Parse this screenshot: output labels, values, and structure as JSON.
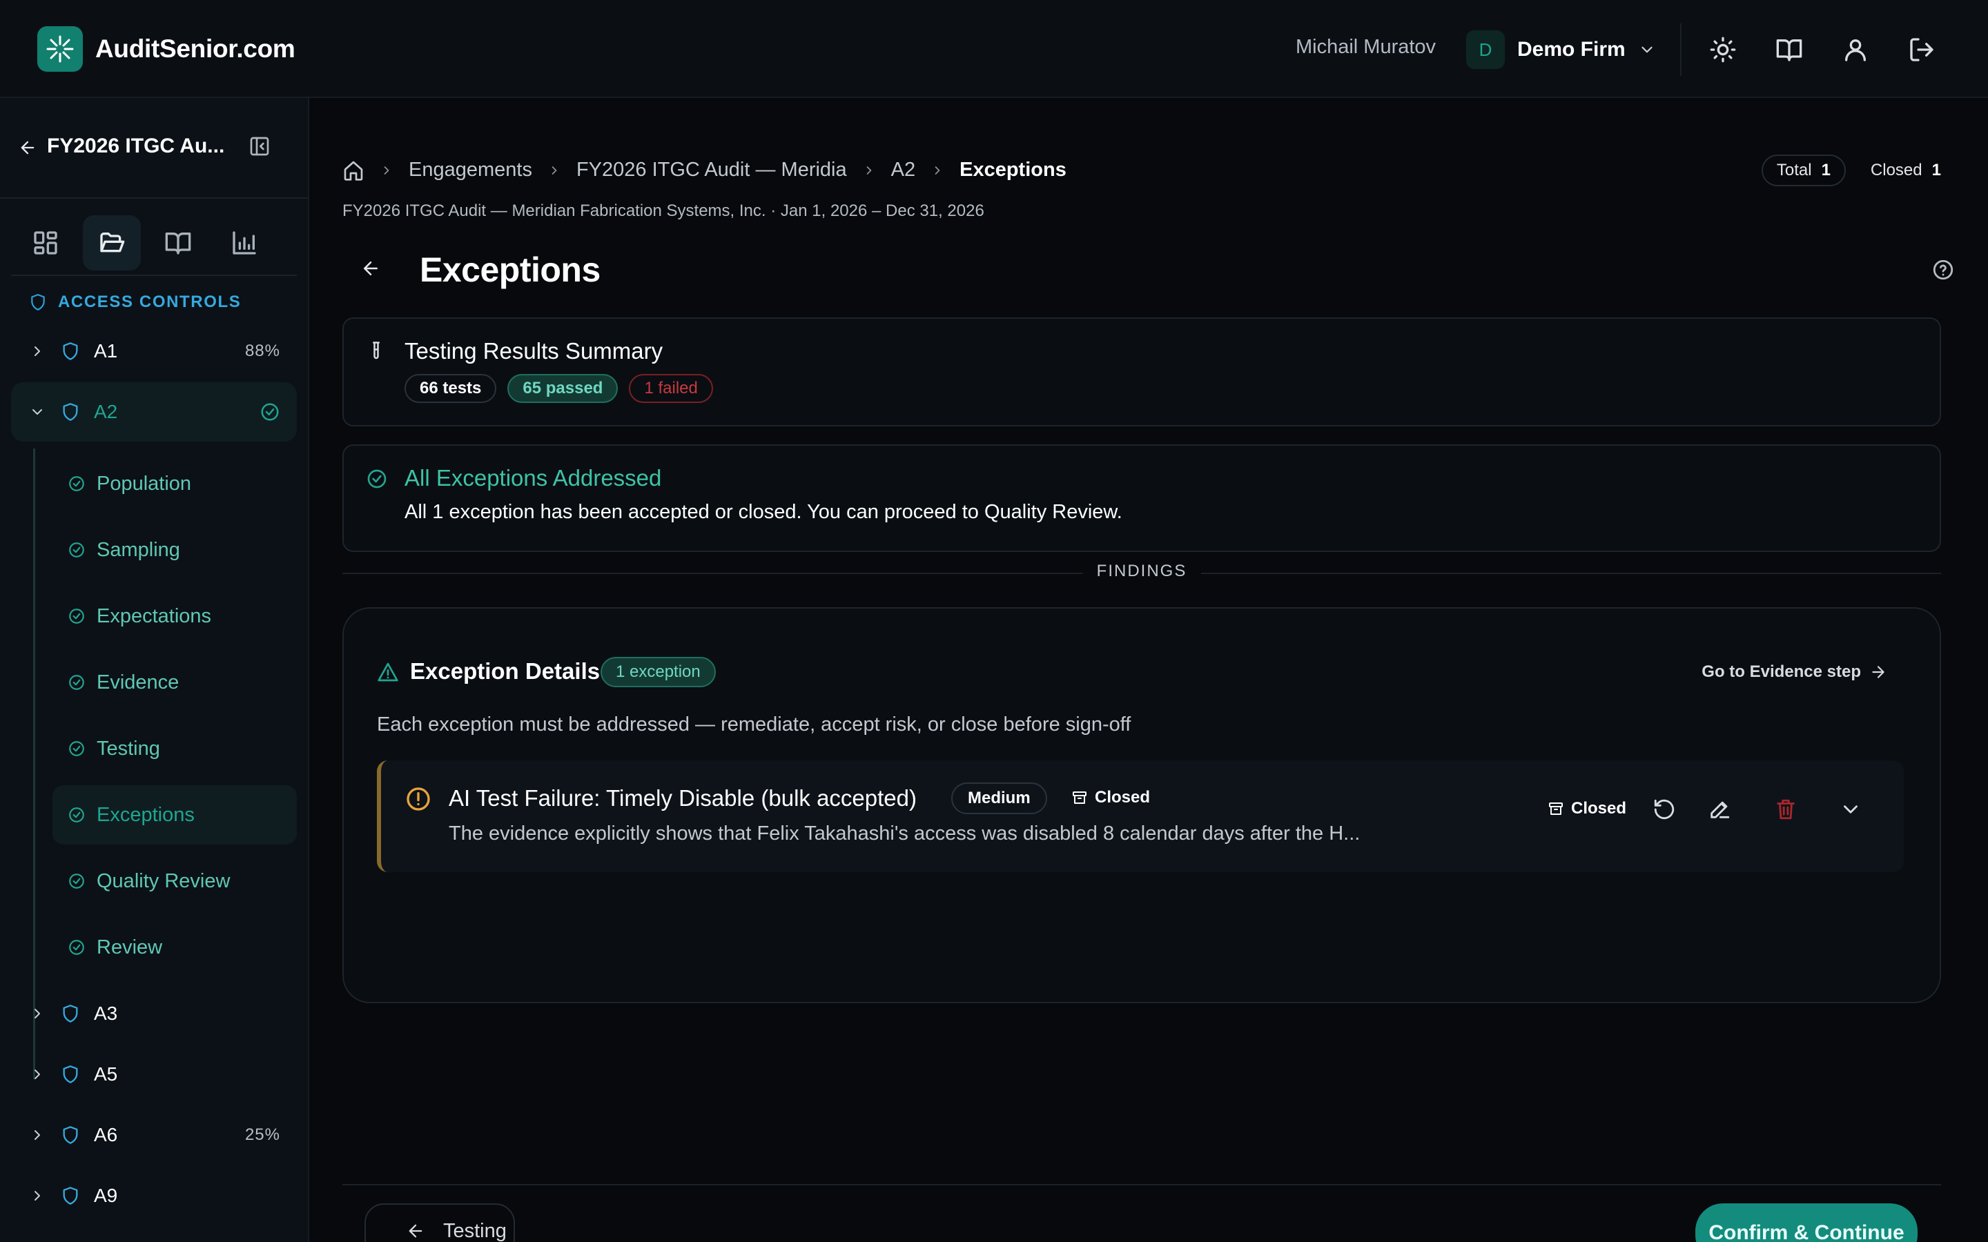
{
  "header": {
    "brand": "AuditSenior.com",
    "user_name": "Michail Muratov",
    "firm_initial": "D",
    "firm_name": "Demo Firm",
    "icons": [
      "sun-icon",
      "book-icon",
      "user-icon",
      "logout-icon"
    ]
  },
  "sidebar": {
    "engagement_title": "FY2026 ITGC Au...",
    "tabs": [
      "dashboard-icon",
      "folder-open-icon",
      "book-icon",
      "bar-chart-icon"
    ],
    "active_tab": 1,
    "section_label": "ACCESS CONTROLS",
    "controls": [
      {
        "label": "A1",
        "progress": "88%",
        "expanded": false
      },
      {
        "label": "A2",
        "progress": "",
        "expanded": true,
        "complete": true
      },
      {
        "label": "A3",
        "progress": "",
        "expanded": false
      },
      {
        "label": "A5",
        "progress": "",
        "expanded": false
      },
      {
        "label": "A6",
        "progress": "25%",
        "expanded": false
      },
      {
        "label": "A9",
        "progress": "",
        "expanded": false
      }
    ],
    "steps": [
      "Population",
      "Sampling",
      "Expectations",
      "Evidence",
      "Testing",
      "Exceptions",
      "Quality Review",
      "Review"
    ],
    "active_step": "Exceptions"
  },
  "breadcrumb": {
    "items": [
      "Engagements",
      "FY2026 ITGC Audit — Meridia",
      "A2"
    ],
    "current": "Exceptions"
  },
  "counters": {
    "total_label": "Total",
    "total_value": "1",
    "closed_label": "Closed",
    "closed_value": "1"
  },
  "engagement_line": "FY2026 ITGC Audit — Meridian Fabrication Systems, Inc.  ·  Jan 1, 2026 – Dec 31, 2026",
  "page_title": "Exceptions",
  "testing_summary": {
    "title": "Testing Results Summary",
    "tests": "66 tests",
    "passed": "65 passed",
    "failed": "1 failed"
  },
  "addressed": {
    "title": "All Exceptions Addressed",
    "message": "All 1 exception has been accepted or closed. You can proceed to Quality Review."
  },
  "findings_label": "FINDINGS",
  "exception_details": {
    "title": "Exception Details",
    "badge": "1 exception",
    "link": "Go to Evidence step",
    "description": "Each exception must be addressed — remediate, accept risk, or close before sign-off",
    "items": [
      {
        "title": "AI Test Failure: Timely Disable (bulk accepted)",
        "severity": "Medium",
        "status": "Closed",
        "summary": "The evidence explicitly shows that Felix Takahashi's access was disabled 8 calendar days after the H...",
        "action_status": "Closed"
      }
    ]
  },
  "footer": {
    "prev_label": "Testing",
    "next_label": "Confirm & Continue"
  },
  "colors": {
    "background": "#07090c",
    "accent": "#138c7d",
    "success": "#3ec3a5",
    "danger": "#c73a3f",
    "warning": "#e8a53a",
    "info": "#35a9df"
  }
}
